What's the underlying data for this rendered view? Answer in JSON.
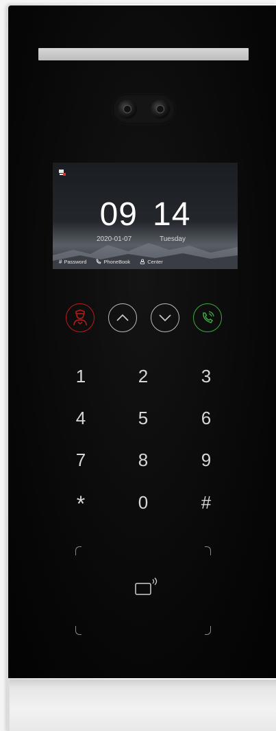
{
  "screen": {
    "time_hours": "09",
    "time_minutes": "14",
    "date": "2020-01-07",
    "weekday": "Tuesday",
    "footer": [
      {
        "icon": "#",
        "label": "Password"
      },
      {
        "icon": "phone-book-icon",
        "label": "PhoneBook"
      },
      {
        "icon": "center-icon",
        "label": "Center"
      }
    ]
  },
  "function_buttons": [
    {
      "name": "guard-icon",
      "color": "#c01a1a"
    },
    {
      "name": "chevron-up-icon",
      "color": "#bdbdbd"
    },
    {
      "name": "chevron-down-icon",
      "color": "#bdbdbd"
    },
    {
      "name": "phone-call-icon",
      "color": "#3caa44"
    }
  ],
  "keypad": {
    "k1": "1",
    "k2": "2",
    "k3": "3",
    "k4": "4",
    "k5": "5",
    "k6": "6",
    "k7": "7",
    "k8": "8",
    "k9": "9",
    "kstar": "*",
    "k0": "0",
    "khash": "#"
  },
  "card_reader": {
    "icon": "nfc-card-icon"
  }
}
